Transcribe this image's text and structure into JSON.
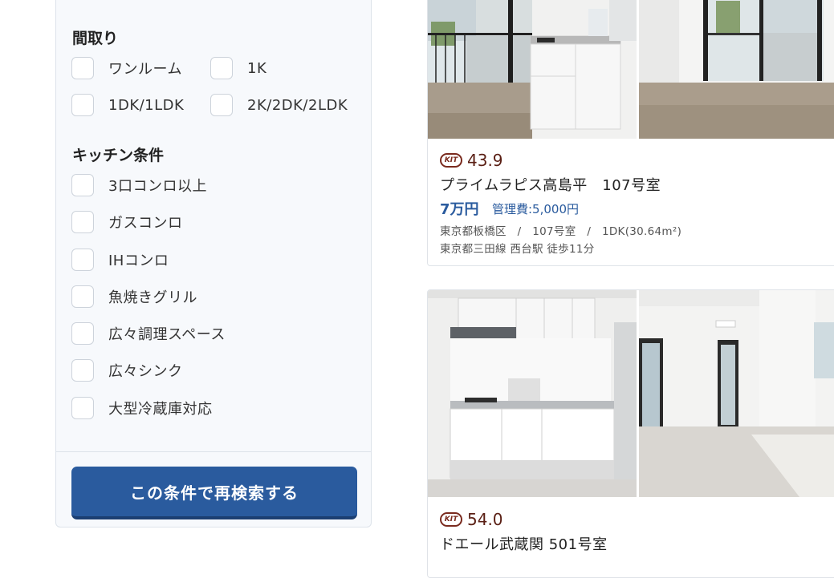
{
  "filter": {
    "layout": {
      "title": "間取り",
      "options": [
        "ワンルーム",
        "1K",
        "1DK/1LDK",
        "2K/2DK/2LDK"
      ]
    },
    "kitchen": {
      "title": "キッチン条件",
      "options": [
        "3口コンロ以上",
        "ガスコンロ",
        "IHコンロ",
        "魚焼きグリル",
        "広々調理スペース",
        "広々シンク",
        "大型冷蔵庫対応"
      ]
    },
    "search_button": "この条件で再検索する"
  },
  "listings": [
    {
      "kit_badge": "KIT",
      "kit_score": "43.9",
      "title": "プライムラピス高島平　107号室",
      "rent": "7万円",
      "fee": "管理費:5,000円",
      "details": "東京都板橋区　/　107号室　/　1DK(30.64m²)",
      "access": "東京都三田線 西台駅 徒歩11分"
    },
    {
      "kit_badge": "KIT",
      "kit_score": "54.0",
      "title": "ドエール武蔵関 501号室"
    }
  ],
  "colors": {
    "accent": "#2a5b9e",
    "kit_brand": "#7a2a1e",
    "panel_bg": "#f7f9fc"
  }
}
